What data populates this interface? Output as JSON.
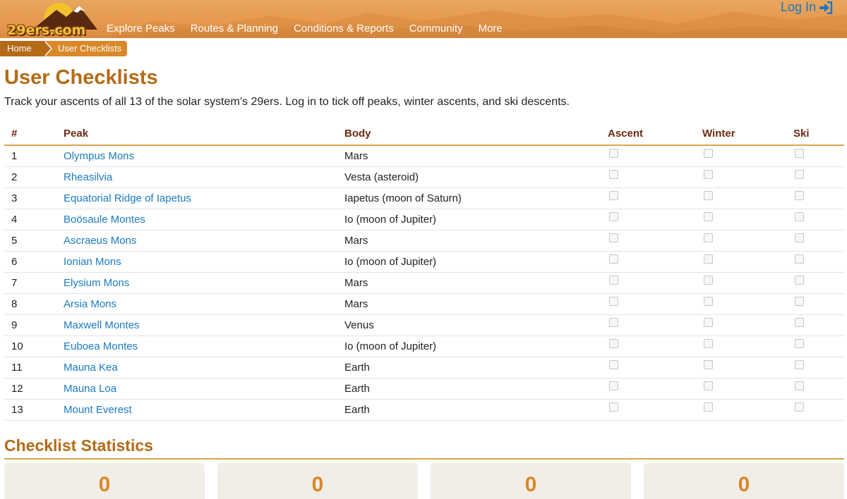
{
  "header": {
    "logo_text": "29ers.com",
    "nav": [
      "Explore Peaks",
      "Routes & Planning",
      "Conditions & Reports",
      "Community",
      "More"
    ],
    "login_label": "Log In"
  },
  "breadcrumb": {
    "home": "Home",
    "current": "User Checklists"
  },
  "page": {
    "title": "User Checklists",
    "intro": "Track your ascents of all 13 of the solar system’s 29ers. Log in to tick off peaks, winter ascents, and ski descents."
  },
  "table": {
    "headers": {
      "num": "#",
      "peak": "Peak",
      "body": "Body",
      "ascent": "Ascent",
      "winter": "Winter",
      "ski": "Ski"
    },
    "rows": [
      {
        "num": "1",
        "peak": "Olympus Mons",
        "body": "Mars",
        "ascent": false,
        "winter": false,
        "ski": false
      },
      {
        "num": "2",
        "peak": "Rheasilvia",
        "body": "Vesta (asteroid)",
        "ascent": false,
        "winter": false,
        "ski": false
      },
      {
        "num": "3",
        "peak": "Equatorial Ridge of Iapetus",
        "body": "Iapetus (moon of Saturn)",
        "ascent": false,
        "winter": false,
        "ski": false
      },
      {
        "num": "4",
        "peak": "Boösaule Montes",
        "body": "Io (moon of Jupiter)",
        "ascent": false,
        "winter": false,
        "ski": false
      },
      {
        "num": "5",
        "peak": "Ascraeus Mons",
        "body": "Mars",
        "ascent": false,
        "winter": false,
        "ski": false
      },
      {
        "num": "6",
        "peak": "Ionian Mons",
        "body": "Io (moon of Jupiter)",
        "ascent": false,
        "winter": false,
        "ski": false
      },
      {
        "num": "7",
        "peak": "Elysium Mons",
        "body": "Mars",
        "ascent": false,
        "winter": false,
        "ski": false
      },
      {
        "num": "8",
        "peak": "Arsia Mons",
        "body": "Mars",
        "ascent": false,
        "winter": false,
        "ski": false
      },
      {
        "num": "9",
        "peak": "Maxwell Montes",
        "body": "Venus",
        "ascent": false,
        "winter": false,
        "ski": false
      },
      {
        "num": "10",
        "peak": "Euboea Montes",
        "body": "Io (moon of Jupiter)",
        "ascent": false,
        "winter": false,
        "ski": false
      },
      {
        "num": "11",
        "peak": "Mauna Kea",
        "body": "Earth",
        "ascent": false,
        "winter": false,
        "ski": false
      },
      {
        "num": "12",
        "peak": "Mauna Loa",
        "body": "Earth",
        "ascent": false,
        "winter": false,
        "ski": false
      },
      {
        "num": "13",
        "peak": "Mount Everest",
        "body": "Earth",
        "ascent": false,
        "winter": false,
        "ski": false
      }
    ]
  },
  "statistics": {
    "title": "Checklist Statistics",
    "values": [
      "0",
      "0",
      "0",
      "0"
    ]
  },
  "colors": {
    "accent": "#b46a17",
    "link": "#1a7ac2",
    "header_text": "#6b2a12",
    "stat_value": "#d9882a"
  },
  "icons": {
    "login": "sign-in-icon",
    "logo": "mountain-sun-logo"
  }
}
